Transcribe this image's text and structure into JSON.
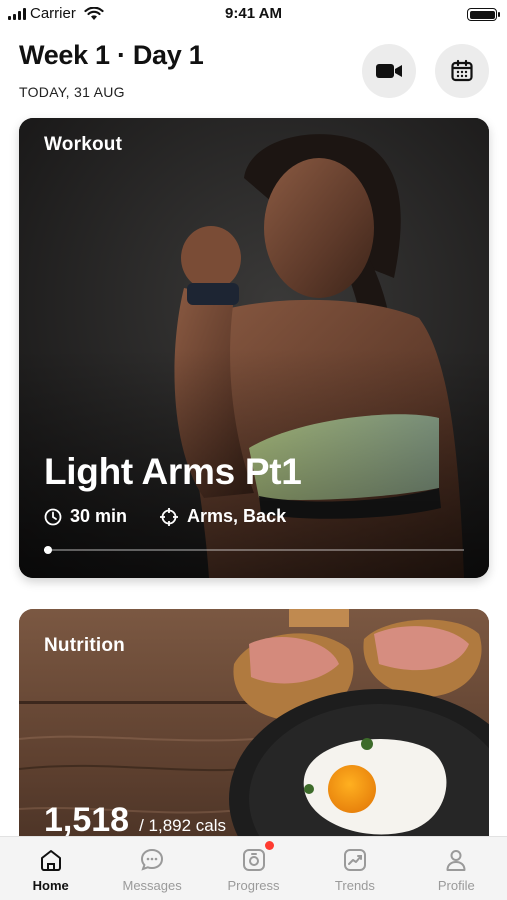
{
  "status_bar": {
    "carrier": "Carrier",
    "time": "9:41 AM"
  },
  "header": {
    "title": "Week 1 · Day 1",
    "date": "TODAY, 31 AUG",
    "video_icon": "video-camera-icon",
    "calendar_icon": "calendar-icon"
  },
  "workout": {
    "label": "Workout",
    "title": "Light Arms Pt1",
    "duration": "30 min",
    "target": "Arms, Back",
    "progress": 0.01
  },
  "nutrition": {
    "label": "Nutrition",
    "calories": "1,518",
    "calories_goal": "/ 1,892 cals"
  },
  "tabs": [
    {
      "label": "Home",
      "icon": "home-icon",
      "active": true
    },
    {
      "label": "Messages",
      "icon": "messages-icon",
      "active": false
    },
    {
      "label": "Progress",
      "icon": "progress-camera-icon",
      "active": false,
      "badge": true
    },
    {
      "label": "Trends",
      "icon": "trends-icon",
      "active": false
    },
    {
      "label": "Profile",
      "icon": "profile-icon",
      "active": false
    }
  ],
  "colors": {
    "badge": "#ff3b30",
    "active_tab": "#111111",
    "inactive_tab": "#9a9a9a"
  }
}
